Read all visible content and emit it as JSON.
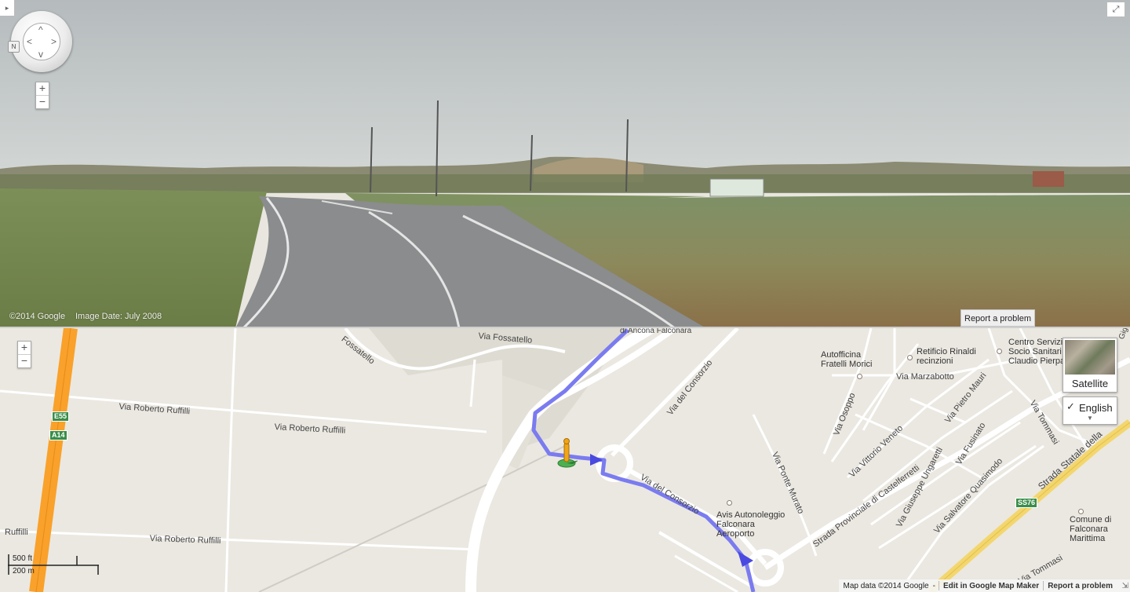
{
  "streetview": {
    "corner_label": "▸",
    "fullscreen_icon": "⤢",
    "compass_label": "N",
    "nav_arrows": {
      "up": "^",
      "down": "v",
      "left": "<",
      "right": ">"
    },
    "zoom_in": "+",
    "zoom_out": "−",
    "copyright": "©2014 Google",
    "image_date": "Image Date: July 2008",
    "report_problem": "Report a problem"
  },
  "map": {
    "zoom_in": "+",
    "zoom_out": "−",
    "satellite_label": "Satellite",
    "language": {
      "check": "✓",
      "label": "English",
      "caret": "▼"
    },
    "scale": {
      "imperial": "500 ft",
      "metric": "200 m"
    },
    "footer": {
      "map_data": "Map data ©2014 Google",
      "dash": "-",
      "edit_link": "Edit in Google Map Maker",
      "report": "Report a problem"
    },
    "road_labels": {
      "fossatello_left": "Fossatello",
      "via_fossatello": "Via Fossatello",
      "ruffilli_1": "Via Roberto Ruffilli",
      "ruffilli_2": "Via Roberto Ruffilli",
      "ruffilli_3": "Via Roberto Ruffilli",
      "ruffilli_left": "Ruffilli",
      "consorzio_1": "Via del Consorzio",
      "consorzio_2": "Via del Consorzio",
      "ponte_murato": "Via Ponte Murato",
      "sp_castelferretti": "Strada Provinciale di Castelferretti",
      "pietro_mauri": "Via Pietro Mauri",
      "vittorio_veneto": "Via Vittorio Veneto",
      "marzabotto": "Via Marzabotto",
      "osoppo": "Via Osoppo",
      "ungaretti": "Via Giuseppe Ungaretti",
      "fusinato": "Via Fusinato",
      "quasimodo": "Via Salvatore Quasimodo",
      "statale": "Strada Statale della",
      "tommasi_1": "Via Tommasi",
      "tommasi_2": "Via Tommasi",
      "ancona_falconara": "di Ancona Falconara",
      "esino_partial": "Esino",
      "gigli_partial": "Gigli"
    },
    "shields": {
      "e55": "E55",
      "a14": "A14",
      "ss76": "SS76"
    },
    "pois": {
      "autofficina": [
        "Autofficina",
        "Fratelli Morici"
      ],
      "retificio": [
        "Retificio Rinaldi",
        "recinzioni"
      ],
      "centro": [
        "Centro Servizi",
        "Socio Sanitari",
        "Claudio Pierpa"
      ],
      "avis": [
        "Avis Autonoleggio",
        "Falconara",
        "Aeroporto"
      ],
      "comune": [
        "Comune di",
        "Falconara",
        "Marittima"
      ]
    },
    "colors": {
      "highway": "#f9a12a",
      "route": "#7b7bf0",
      "land": "#ebe8e1",
      "primary_road": "#f3d66e"
    }
  }
}
